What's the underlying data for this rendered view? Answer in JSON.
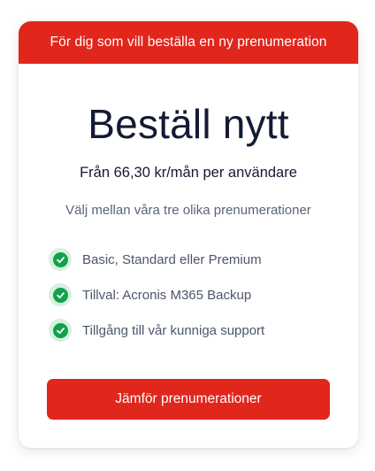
{
  "colors": {
    "accent": "#e1261c",
    "check_bg": "#d6f1dd",
    "check_fg": "#12a14a"
  },
  "card": {
    "banner_text": "För dig som vill beställa en ny prenumeration",
    "title": "Beställ nytt",
    "price": "Från 66,30 kr/mån per användare",
    "subtitle": "Välj mellan våra tre olika prenumerationer",
    "features": [
      {
        "label": "Basic, Standard eller Premium",
        "icon": "check-circle-icon"
      },
      {
        "label": "Tillval: Acronis M365 Backup",
        "icon": "check-circle-icon"
      },
      {
        "label": "Tillgång till vår kunniga support",
        "icon": "check-circle-icon"
      }
    ],
    "cta_label": "Jämför prenumerationer"
  }
}
